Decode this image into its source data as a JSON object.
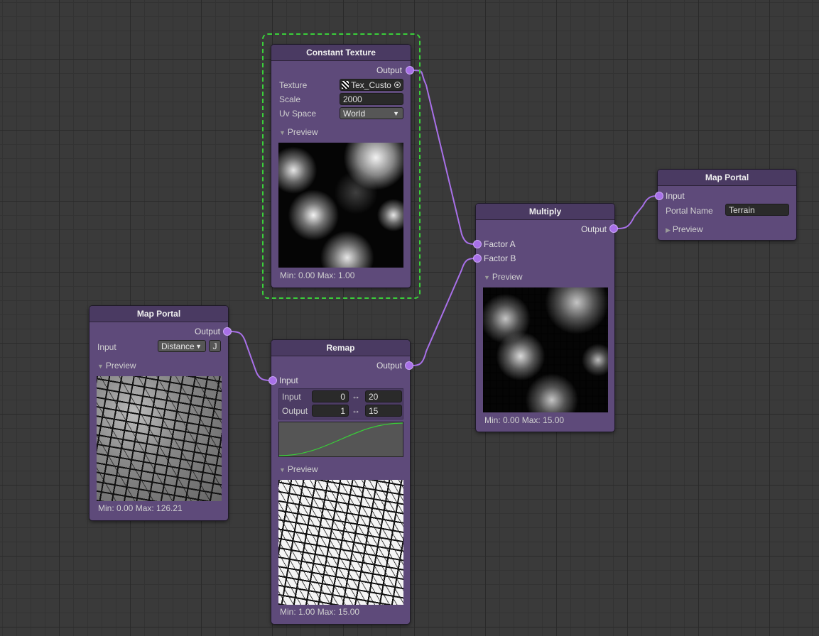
{
  "nodes": {
    "constant_texture": {
      "title": "Constant Texture",
      "output_label": "Output",
      "texture_label": "Texture",
      "texture_value": "Tex_Custo",
      "scale_label": "Scale",
      "scale_value": "2000",
      "uv_space_label": "Uv Space",
      "uv_space_value": "World",
      "preview_label": "Preview",
      "minmax": "Min: 0.00 Max: 1.00"
    },
    "multiply": {
      "title": "Multiply",
      "output_label": "Output",
      "factor_a_label": "Factor A",
      "factor_b_label": "Factor B",
      "preview_label": "Preview",
      "minmax": "Min: 0.00 Max: 15.00"
    },
    "map_portal_terrain": {
      "title": "Map Portal",
      "input_label": "Input",
      "portal_name_label": "Portal Name",
      "portal_name_value": "Terrain",
      "preview_label": "Preview"
    },
    "map_portal_distance": {
      "title": "Map Portal",
      "output_label": "Output",
      "input_label": "Input",
      "input_value": "Distance",
      "input_button": "J",
      "preview_label": "Preview",
      "minmax": "Min: 0.00 Max: 126.21"
    },
    "remap": {
      "title": "Remap",
      "output_label": "Output",
      "input_label": "Input",
      "range_input_label": "Input",
      "range_input_min": "0",
      "range_input_max": "20",
      "range_output_label": "Output",
      "range_output_min": "1",
      "range_output_max": "15",
      "range_arrow": "↔",
      "preview_label": "Preview",
      "minmax": "Min: 1.00 Max: 15.00"
    }
  },
  "colors": {
    "node_body": "#5e4a7a",
    "node_header": "#4a3a62",
    "port": "#a870e8",
    "wire": "#a870e8",
    "selection": "#3ad03a",
    "curve": "#38d038"
  },
  "icons": {
    "collapse_expanded": "triangle-down",
    "collapse_collapsed": "triangle-right",
    "object_picker": "target-circle",
    "dropdown": "caret-down"
  }
}
